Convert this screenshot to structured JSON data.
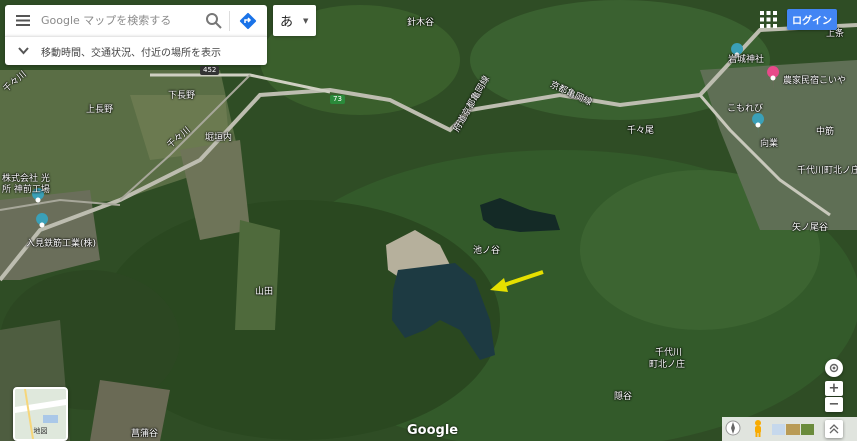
{
  "search": {
    "placeholder": "Google マップを検索する",
    "sub_label": "移動時間、交通状況、付近の場所を表示"
  },
  "ime": {
    "label": "あ"
  },
  "header": {
    "login_label": "ログイン"
  },
  "map": {
    "labels": [
      {
        "text": "上長野"
      },
      {
        "text": "下長野"
      },
      {
        "text": "堀垣内"
      },
      {
        "text": "株式会社 光"
      },
      {
        "text": "所 神前工場"
      },
      {
        "text": "入見鉄筋工業(株)"
      },
      {
        "text": "山田"
      },
      {
        "text": "池ノ谷"
      },
      {
        "text": "千々尾"
      },
      {
        "text": "矢ノ尾谷"
      },
      {
        "text": "千代川"
      },
      {
        "text": "町北ノ庄"
      },
      {
        "text": "隠谷"
      },
      {
        "text": "菖蒲谷"
      },
      {
        "text": "針木谷"
      },
      {
        "text": "岩城神社"
      },
      {
        "text": "農家民宿こいや"
      },
      {
        "text": "こもれび"
      },
      {
        "text": "向業"
      },
      {
        "text": "中筋"
      },
      {
        "text": "千代川町北ノ庄"
      },
      {
        "text": "上条"
      },
      {
        "text": "千々川"
      },
      {
        "text": "千々川"
      },
      {
        "text": "府道京都亀岡線"
      },
      {
        "text": "京都亀岡線"
      }
    ],
    "route_shields": [
      "452",
      "73"
    ]
  },
  "layers": {
    "label": "地図"
  },
  "footer": {
    "logo": "Google"
  },
  "icons": {
    "menu": "menu-icon",
    "search": "search-icon",
    "directions": "directions-icon",
    "chevron": "chevron-down-icon",
    "apps": "apps-grid-icon",
    "zoom_in": "plus-icon",
    "zoom_out": "minus-icon",
    "pegman": "pegman-icon",
    "compass": "compass-icon"
  },
  "colors": {
    "accent": "#4285f4",
    "directions": "#1a73e8",
    "marker_teal": "#3aa0b8",
    "marker_pink": "#e84a8a",
    "arrow": "#e6e000"
  }
}
